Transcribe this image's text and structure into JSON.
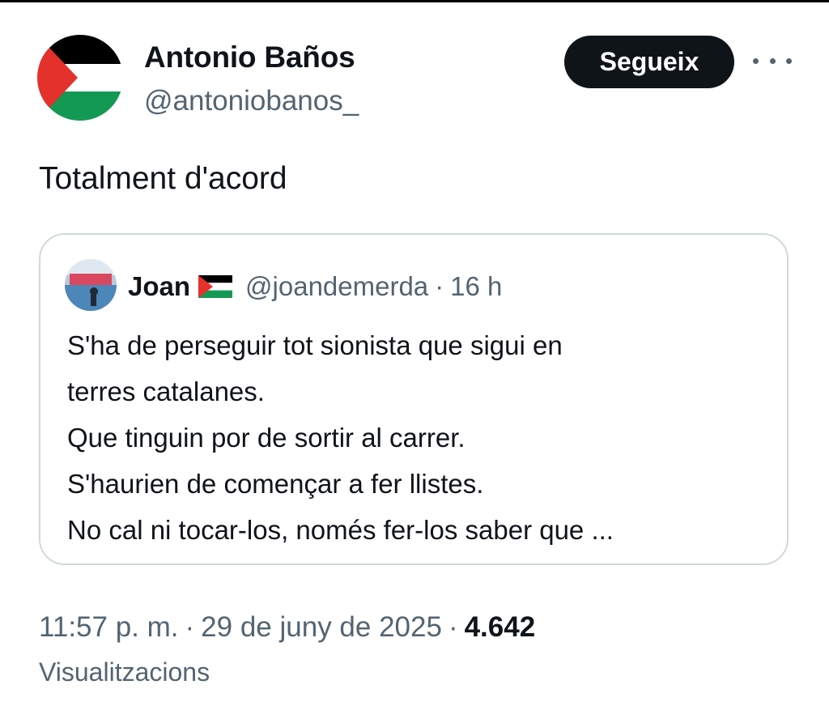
{
  "post": {
    "author": {
      "display_name": "Antonio Baños",
      "handle": "@antoniobanos_",
      "avatar_icon": "palestine-flag-avatar"
    },
    "follow_label": "Segueix",
    "more_icon": "more-options-icon",
    "text": "Totalment d'acord"
  },
  "quote": {
    "name": "Joan",
    "flag_icon": "palestine-flag-icon",
    "handle": "@joandemerda",
    "separator": "·",
    "time": "16 h",
    "lines": [
      "S'ha de perseguir tot sionista que sigui en",
      "terres catalanes.",
      "Que tinguin por de sortir al carrer.",
      "S'haurien de començar a fer llistes.",
      "No cal ni tocar-los, només fer-los saber que ..."
    ]
  },
  "footer": {
    "time": "11:57 p. m.",
    "separator": "·",
    "date": "29 de juny de 2025",
    "views_count": "4.642",
    "views_label": "Visualitzacions"
  },
  "colors": {
    "text_primary": "#0f1419",
    "text_secondary": "#536471",
    "border": "#cfd9de",
    "flag_red": "#e4312b",
    "flag_green": "#149954",
    "flag_black": "#000000"
  }
}
